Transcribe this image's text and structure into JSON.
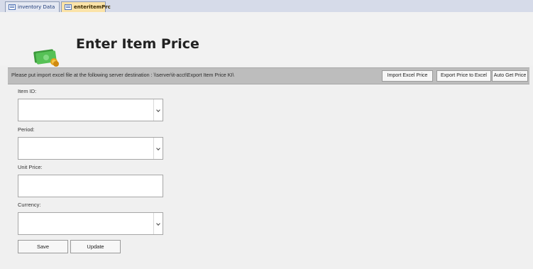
{
  "tabs": [
    {
      "label": "inventory Data",
      "active": false
    },
    {
      "label": "enteritemPrc",
      "active": true
    }
  ],
  "header": {
    "title": "Enter Item Price",
    "logo_icon": "money-icon"
  },
  "infobar": {
    "text": "Please put import excel file at the following server destination : \\\\server\\it-acct\\Export Item Price KI\\",
    "buttons": {
      "import": "Import Excel Price",
      "export": "Export Price to Excel",
      "auto": "Auto Get Price"
    }
  },
  "form": {
    "item_id": {
      "label": "Item ID:",
      "value": ""
    },
    "period": {
      "label": "Period:",
      "value": ""
    },
    "unit_price": {
      "label": "Unit Price:",
      "value": ""
    },
    "currency": {
      "label": "Currency:",
      "value": ""
    }
  },
  "actions": {
    "save": "Save",
    "update": "Update"
  },
  "colors": {
    "active_tab": "#fbe3a8",
    "tab_bar": "#d6dbe9",
    "info_bar": "#bdbdbd",
    "background": "#f0f0f0"
  }
}
